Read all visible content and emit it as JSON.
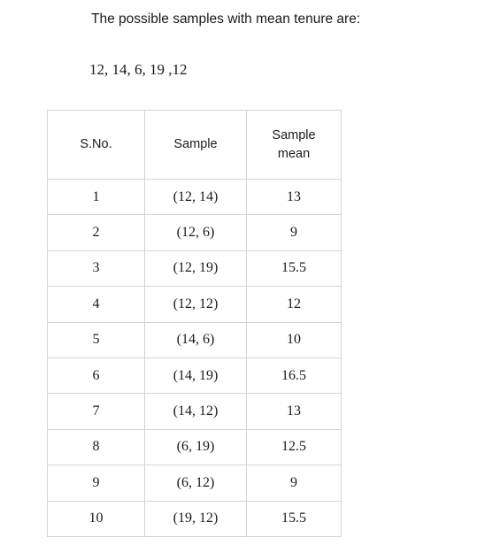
{
  "document": {
    "intro_text": "The possible samples with mean tenure are:",
    "samples_list": "12, 14, 6, 19 ,12",
    "table": {
      "headers": [
        "S.No.",
        "Sample",
        "Sample mean"
      ],
      "rows": [
        {
          "sno": "1",
          "sample": "(12, 14)",
          "mean": "13"
        },
        {
          "sno": "2",
          "sample": "(12, 6)",
          "mean": "9"
        },
        {
          "sno": "3",
          "sample": "(12, 19)",
          "mean": "15.5"
        },
        {
          "sno": "4",
          "sample": "(12, 12)",
          "mean": "12"
        },
        {
          "sno": "5",
          "sample": "(14, 6)",
          "mean": "10"
        },
        {
          "sno": "6",
          "sample": "(14, 19)",
          "mean": "16.5"
        },
        {
          "sno": "7",
          "sample": "(14, 12)",
          "mean": "13"
        },
        {
          "sno": "8",
          "sample": "(6, 19)",
          "mean": "12.5"
        },
        {
          "sno": "9",
          "sample": "(6, 12)",
          "mean": "9"
        },
        {
          "sno": "10",
          "sample": "(19, 12)",
          "mean": "15.5"
        }
      ]
    }
  },
  "colors": {
    "text": "#1a1a1a",
    "border": "#d4d4d4",
    "background": "#ffffff"
  }
}
